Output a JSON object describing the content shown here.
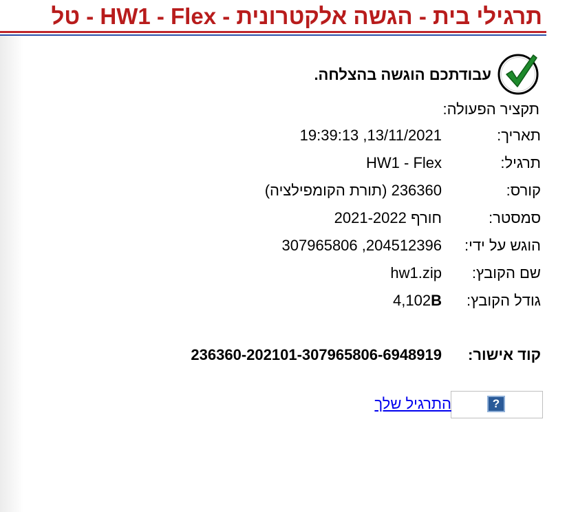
{
  "header": {
    "title": "תרגילי בית - הגשה אלקטרונית - HW1 - Flex - טל"
  },
  "status": {
    "message": "עבודתכם הוגשה בהצלחה.",
    "icon": "check-circle-icon"
  },
  "summary": {
    "title": "תקציר הפעולה:",
    "rows": [
      {
        "label": "תאריך:",
        "value": "19:39:13 ,13/11/2021"
      },
      {
        "label": "תרגיל:",
        "value": "HW1 - Flex"
      },
      {
        "label": "קורס:",
        "value": "236360 (תורת הקומפילציה)"
      },
      {
        "label": "סמסטר:",
        "value": "חורף 2021-2022"
      },
      {
        "label": "הוגש על ידי:",
        "value": "307965806 ,204512396"
      },
      {
        "label": "שם הקובץ:",
        "value": "hw1.zip"
      },
      {
        "label": "גודל הקובץ:",
        "value_number": "4,102",
        "value_unit": "B"
      }
    ]
  },
  "approval": {
    "label": "קוד אישור:",
    "code": "236360-202101-307965806-6948919"
  },
  "help": {
    "icon_text": "?",
    "link_text": "התרגיל שלך"
  },
  "colors": {
    "title_red": "#b81c1c",
    "rule_red": "#c0262b",
    "rule_blue": "#2b4ea8",
    "link_blue": "#0000ee",
    "help_icon_bg": "#2a5a98",
    "check_green": "#1e8a2c"
  }
}
